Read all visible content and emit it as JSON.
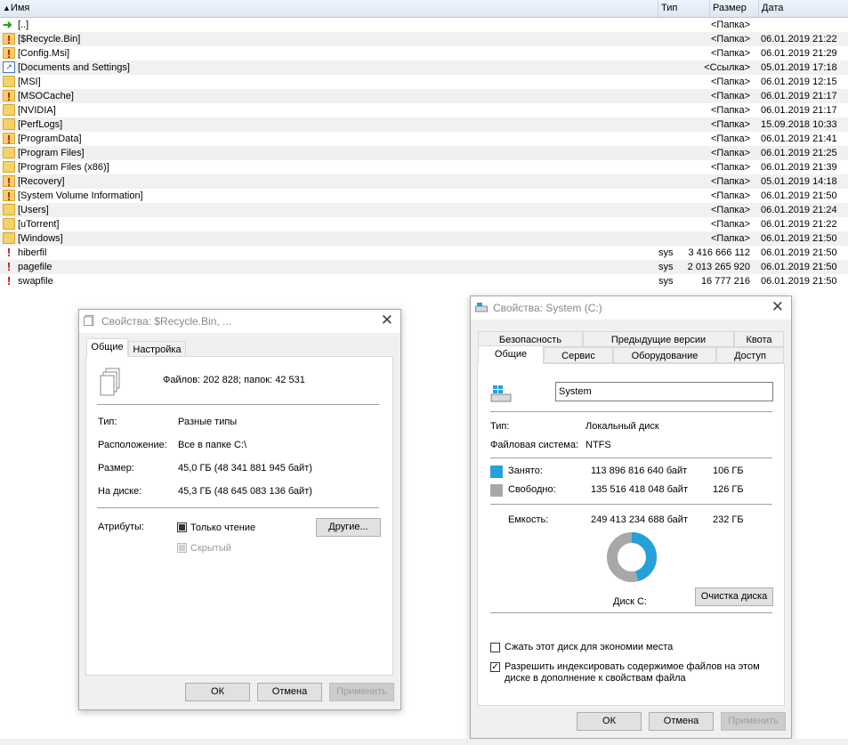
{
  "panel": {
    "header": {
      "name": "Имя",
      "type": "Тип",
      "size": "Размер",
      "date": "Дата"
    },
    "rows": [
      {
        "icon": "up-arrow-icon",
        "name": "[..]",
        "type": "",
        "size": "<Папка>",
        "date": ""
      },
      {
        "icon": "warning-folder-icon",
        "name": "[$Recycle.Bin]",
        "type": "",
        "size": "<Папка>",
        "date": "06.01.2019 21:22"
      },
      {
        "icon": "warning-folder-icon",
        "name": "[Config.Msi]",
        "type": "",
        "size": "<Папка>",
        "date": "06.01.2019 21:29"
      },
      {
        "icon": "link-icon",
        "name": "[Documents and Settings]",
        "type": "",
        "size": "<Ссылка>",
        "date": "05.01.2019 17:18"
      },
      {
        "icon": "folder-icon",
        "name": "[MSI]",
        "type": "",
        "size": "<Папка>",
        "date": "06.01.2019 12:15"
      },
      {
        "icon": "warning-folder-icon",
        "name": "[MSOCache]",
        "type": "",
        "size": "<Папка>",
        "date": "06.01.2019 21:17"
      },
      {
        "icon": "folder-icon",
        "name": "[NVIDIA]",
        "type": "",
        "size": "<Папка>",
        "date": "06.01.2019 21:17"
      },
      {
        "icon": "folder-icon",
        "name": "[PerfLogs]",
        "type": "",
        "size": "<Папка>",
        "date": "15.09.2018 10:33"
      },
      {
        "icon": "warning-folder-icon",
        "name": "[ProgramData]",
        "type": "",
        "size": "<Папка>",
        "date": "06.01.2019 21:41"
      },
      {
        "icon": "folder-icon",
        "name": "[Program Files]",
        "type": "",
        "size": "<Папка>",
        "date": "06.01.2019 21:25"
      },
      {
        "icon": "folder-icon",
        "name": "[Program Files (x86)]",
        "type": "",
        "size": "<Папка>",
        "date": "06.01.2019 21:39"
      },
      {
        "icon": "warning-folder-icon",
        "name": "[Recovery]",
        "type": "",
        "size": "<Папка>",
        "date": "05.01.2019 14:18"
      },
      {
        "icon": "warning-folder-icon",
        "name": "[System Volume Information]",
        "type": "",
        "size": "<Папка>",
        "date": "06.01.2019 21:50"
      },
      {
        "icon": "folder-icon",
        "name": "[Users]",
        "type": "",
        "size": "<Папка>",
        "date": "06.01.2019 21:24"
      },
      {
        "icon": "folder-icon",
        "name": "[uTorrent]",
        "type": "",
        "size": "<Папка>",
        "date": "06.01.2019 21:22"
      },
      {
        "icon": "folder-icon",
        "name": "[Windows]",
        "type": "",
        "size": "<Папка>",
        "date": "06.01.2019 21:50"
      },
      {
        "icon": "warning-file-icon",
        "name": "hiberfil",
        "type": "sys",
        "size": "3 416 666 112",
        "date": "06.01.2019 21:50"
      },
      {
        "icon": "warning-file-icon",
        "name": "pagefile",
        "type": "sys",
        "size": "2 013 265 920",
        "date": "06.01.2019 21:50"
      },
      {
        "icon": "warning-file-icon",
        "name": "swapfile",
        "type": "sys",
        "size": "16 777 216",
        "date": "06.01.2019 21:50"
      }
    ]
  },
  "recycle_dialog": {
    "title": "Свойства: $Recycle.Bin, ...",
    "tabs": [
      "Общие",
      "Настройка"
    ],
    "summary": "Файлов: 202 828; папок: 42 531",
    "type_label": "Тип:",
    "type_value": "Разные типы",
    "location_label": "Расположение:",
    "location_value": "Все в папке C:\\",
    "size_label": "Размер:",
    "size_value": "45,0 ГБ (48 341 881 945 байт)",
    "ondisk_label": "На диске:",
    "ondisk_value": "45,3 ГБ (48 645 083 136 байт)",
    "attributes_label": "Атрибуты:",
    "readonly_label": "Только чтение",
    "hidden_label": "Скрытый",
    "other_button": "Другие...",
    "ok": "ОК",
    "cancel": "Отмена",
    "apply": "Применить"
  },
  "system_dialog": {
    "title": "Свойства: System (C:)",
    "tabs_top": [
      "Безопасность",
      "Предыдущие версии",
      "Квота"
    ],
    "tabs_bottom": [
      "Общие",
      "Сервис",
      "Оборудование",
      "Доступ"
    ],
    "volume_name": "System",
    "type_label": "Тип:",
    "type_value": "Локальный диск",
    "fs_label": "Файловая система:",
    "fs_value": "NTFS",
    "used_label": "Занято:",
    "used_bytes": "113 896 816 640 байт",
    "used_gb": "106 ГБ",
    "free_label": "Свободно:",
    "free_bytes": "135 516 418 048 байт",
    "free_gb": "126 ГБ",
    "capacity_label": "Емкость:",
    "capacity_bytes": "249 413 234 688 байт",
    "capacity_gb": "232 ГБ",
    "disk_label": "Диск C:",
    "cleanup_button": "Очистка диска",
    "compress_label": "Сжать этот диск для экономии места",
    "index_label": "Разрешить индексировать содержимое файлов на этом диске в дополнение к свойствам файла",
    "used_fraction": 0.457,
    "colors": {
      "used": "#26a0da",
      "free": "#a8a8a8"
    },
    "ok": "ОК",
    "cancel": "Отмена",
    "apply": "Применить"
  }
}
